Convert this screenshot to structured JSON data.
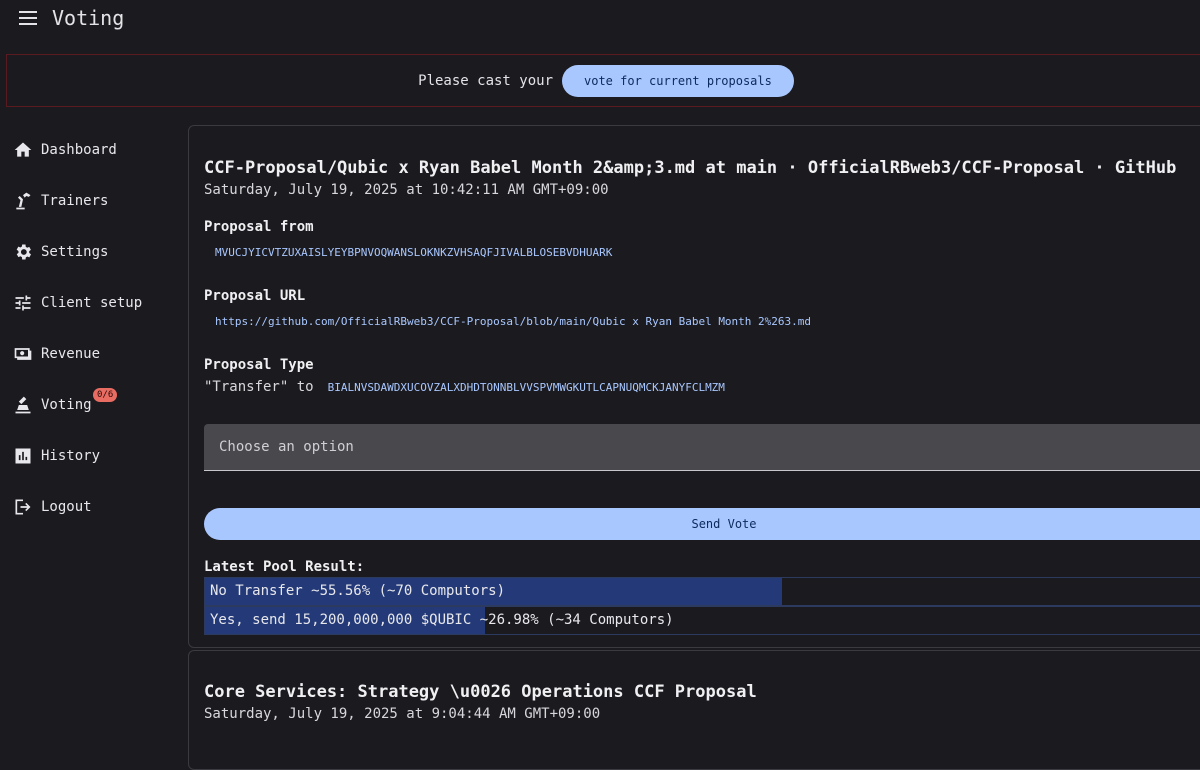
{
  "app": {
    "title": "Voting"
  },
  "banner": {
    "text": "Please cast your",
    "button_label": "vote for current proposals"
  },
  "sidebar": {
    "items": [
      {
        "label": "Dashboard"
      },
      {
        "label": "Trainers"
      },
      {
        "label": "Settings"
      },
      {
        "label": "Client setup"
      },
      {
        "label": "Revenue"
      },
      {
        "label": "Voting",
        "badge": "0/6"
      },
      {
        "label": "History"
      },
      {
        "label": "Logout"
      }
    ]
  },
  "proposals": [
    {
      "title": "CCF-Proposal/Qubic x Ryan Babel Month 2&amp;3.md at main · OfficialRBweb3/CCF-Proposal · GitHub",
      "date": "Saturday, July 19, 2025 at 10:42:11 AM GMT+09:00",
      "from_label": "Proposal from",
      "from": "MVUCJYICVTZUXAISLYEYBPNVOQWANSLOKNKZVHSAQFJIVALBLOSEBVDHUARK",
      "url_label": "Proposal URL",
      "url": "https://github.com/OfficialRBweb3/CCF-Proposal/blob/main/Qubic x Ryan Babel Month 2%263.md",
      "type_label": "Proposal Type",
      "type_text": "\"Transfer\" to",
      "type_address": "BIALNVSDAWDXUCOVZALXDHDTONNBLVVSPVMWGKUTLCAPNUQMCKJANYFCLMZM",
      "select_placeholder": "Choose an option",
      "send_label": "Send Vote",
      "pool_label": "Latest Pool Result:",
      "pool_results": [
        {
          "text": "No Transfer ~55.56% (~70 Computors)",
          "percent": 55.56
        },
        {
          "text": "Yes, send 15,200,000,000 $QUBIC ~26.98% (~34 Computors)",
          "percent": 26.98
        }
      ]
    },
    {
      "title": "Core Services: Strategy \\u0026 Operations CCF Proposal",
      "date": "Saturday, July 19, 2025 at 9:04:44 AM GMT+09:00"
    }
  ],
  "colors": {
    "accent": "#a9c7ff",
    "pool_fill": "#243a78",
    "badge": "#e86c62",
    "banner_border": "#5a1a1f"
  }
}
